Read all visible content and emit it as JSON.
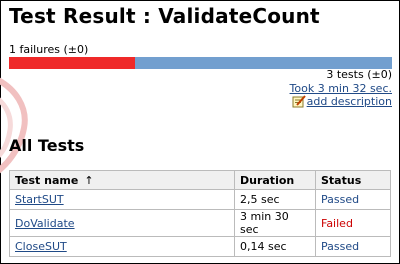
{
  "header": {
    "title": "Test Result : ValidateCount"
  },
  "summary": {
    "failures_label": "1 failures (±0)",
    "fail_fraction": 0.33,
    "colors": {
      "fail": "#ef2929",
      "pass": "#729fcf"
    },
    "tests_label": "3 tests (±0)",
    "took_label": "Took 3 min 32 sec.",
    "add_description_label": "add description"
  },
  "all_tests": {
    "heading": "All Tests",
    "columns": {
      "name": "Test name",
      "sort_indicator": "↑",
      "duration": "Duration",
      "status": "Status"
    },
    "rows": [
      {
        "name": "StartSUT",
        "duration": "2,5 sec",
        "status": "Passed"
      },
      {
        "name": "DoValidate",
        "duration": "3 min 30 sec",
        "status": "Failed"
      },
      {
        "name": "CloseSUT",
        "duration": "0,14 sec",
        "status": "Passed"
      }
    ]
  }
}
